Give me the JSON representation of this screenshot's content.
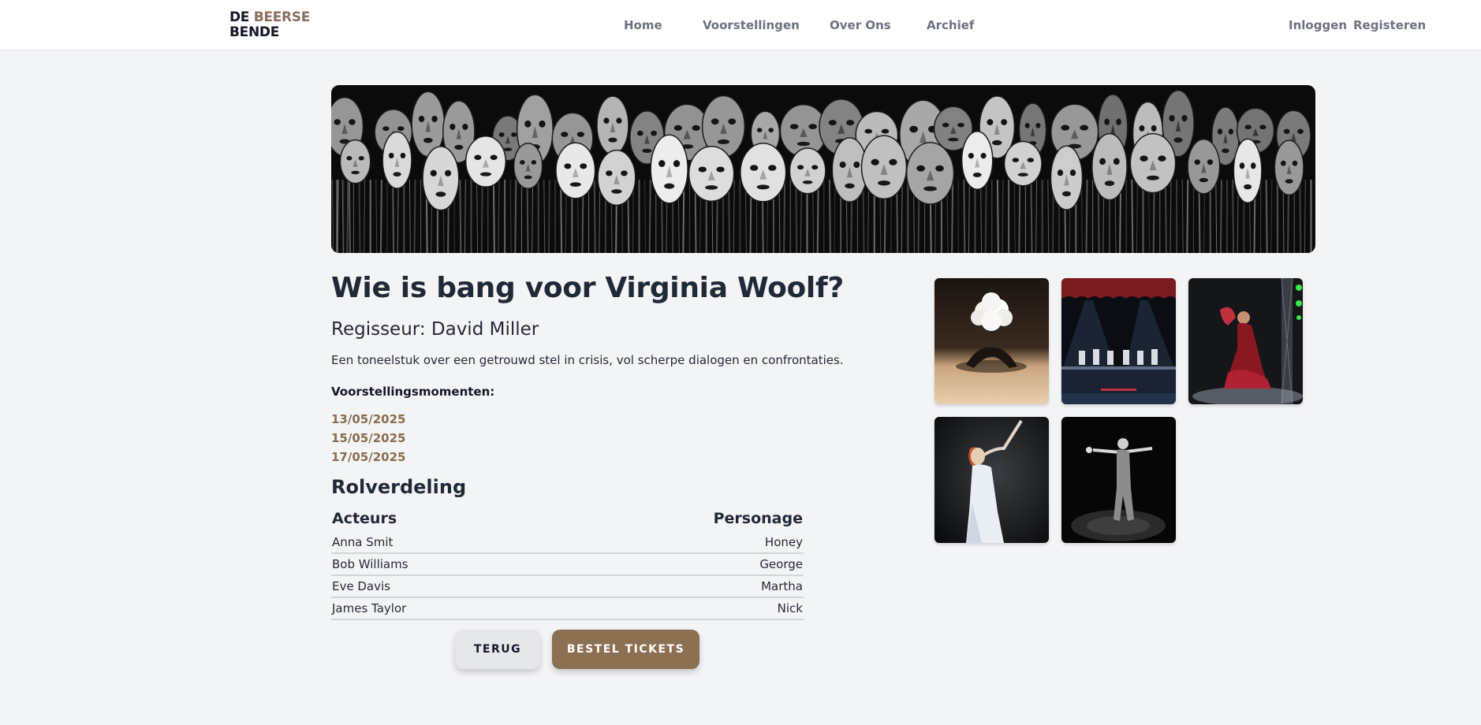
{
  "brand": {
    "line1_dark": "DE",
    "line1_accent": "BEERSE",
    "line2": "BENDE",
    "accent_color": "#8a6d5a"
  },
  "nav": {
    "items": [
      "Home",
      "Voorstellingen",
      "Over Ons",
      "Archief"
    ],
    "login": "Inloggen",
    "register": "Registeren"
  },
  "show": {
    "title": "Wie is bang voor Virginia Woolf?",
    "director": "Regisseur: David Miller",
    "description": "Een toneelstuk over een getrouwd stel in crisis, vol scherpe dialogen en confrontaties.",
    "moments_label": "Voorstellingsmomenten:",
    "moments": [
      "13/05/2025",
      "15/05/2025",
      "17/05/2025"
    ]
  },
  "cast": {
    "title": "Rolverdeling",
    "headers": [
      "Acteurs",
      "Personage"
    ],
    "rows": [
      [
        "Anna Smit",
        "Honey"
      ],
      [
        "Bob Williams",
        "George"
      ],
      [
        "Eve Davis",
        "Martha"
      ],
      [
        "James Taylor",
        "Nick"
      ]
    ]
  },
  "actions": {
    "back": "TERUG",
    "order": "BESTEL TICKETS"
  },
  "gallery": {
    "images": [
      "dancer-cloud-costume",
      "stage-performance-red-curtain",
      "flamenco-dancer-green-lights",
      "woman-white-dress",
      "dancer-spotlight-dark"
    ]
  },
  "hero": {
    "image": "wooden-masks-banner"
  },
  "colors": {
    "accent_date": "#8a6d4a",
    "order_button": "#8b7053",
    "page_bg": "#f3f4f6"
  }
}
